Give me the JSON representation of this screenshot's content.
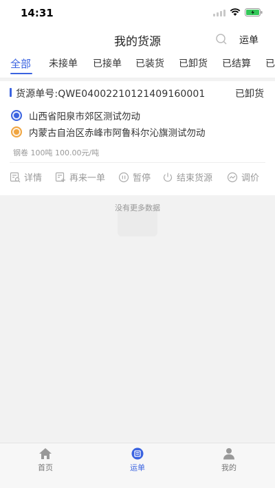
{
  "status_bar": {
    "time": "14:31"
  },
  "nav": {
    "title": "我的货源",
    "search_icon": "search-icon",
    "right_label": "运单"
  },
  "tabs": [
    {
      "label": "全部",
      "active": true
    },
    {
      "label": "未接单",
      "active": false
    },
    {
      "label": "已接单",
      "active": false
    },
    {
      "label": "已装货",
      "active": false
    },
    {
      "label": "已卸货",
      "active": false
    },
    {
      "label": "已结算",
      "active": false
    },
    {
      "label": "已",
      "active": false
    }
  ],
  "order": {
    "number_label": "货源单号:QWE0400221012140916000​1",
    "status": "已卸货",
    "origin": "山西省阳泉市郊区测试勿动",
    "destination": "内蒙古自治区赤峰市阿鲁科尔沁旗测试勿动",
    "goods": "钢卷 100吨 100.00元/吨",
    "actions": [
      {
        "label": "详情",
        "icon": "detail-icon"
      },
      {
        "label": "再来一单",
        "icon": "reorder-icon"
      },
      {
        "label": "暂停",
        "icon": "pause-icon"
      },
      {
        "label": "结束货源",
        "icon": "power-icon"
      },
      {
        "label": "调价",
        "icon": "price-adjust-icon"
      }
    ]
  },
  "list_footer": "没有更多数据",
  "tabbar": [
    {
      "label": "首页",
      "icon": "home-icon",
      "active": false
    },
    {
      "label": "运单",
      "icon": "waybill-icon",
      "active": true
    },
    {
      "label": "我的",
      "icon": "profile-icon",
      "active": false
    }
  ],
  "colors": {
    "accent": "#3a63e0",
    "origin_dot": "#3a63e0",
    "destination_dot": "#f0a540",
    "background": "#f2f2f2"
  }
}
